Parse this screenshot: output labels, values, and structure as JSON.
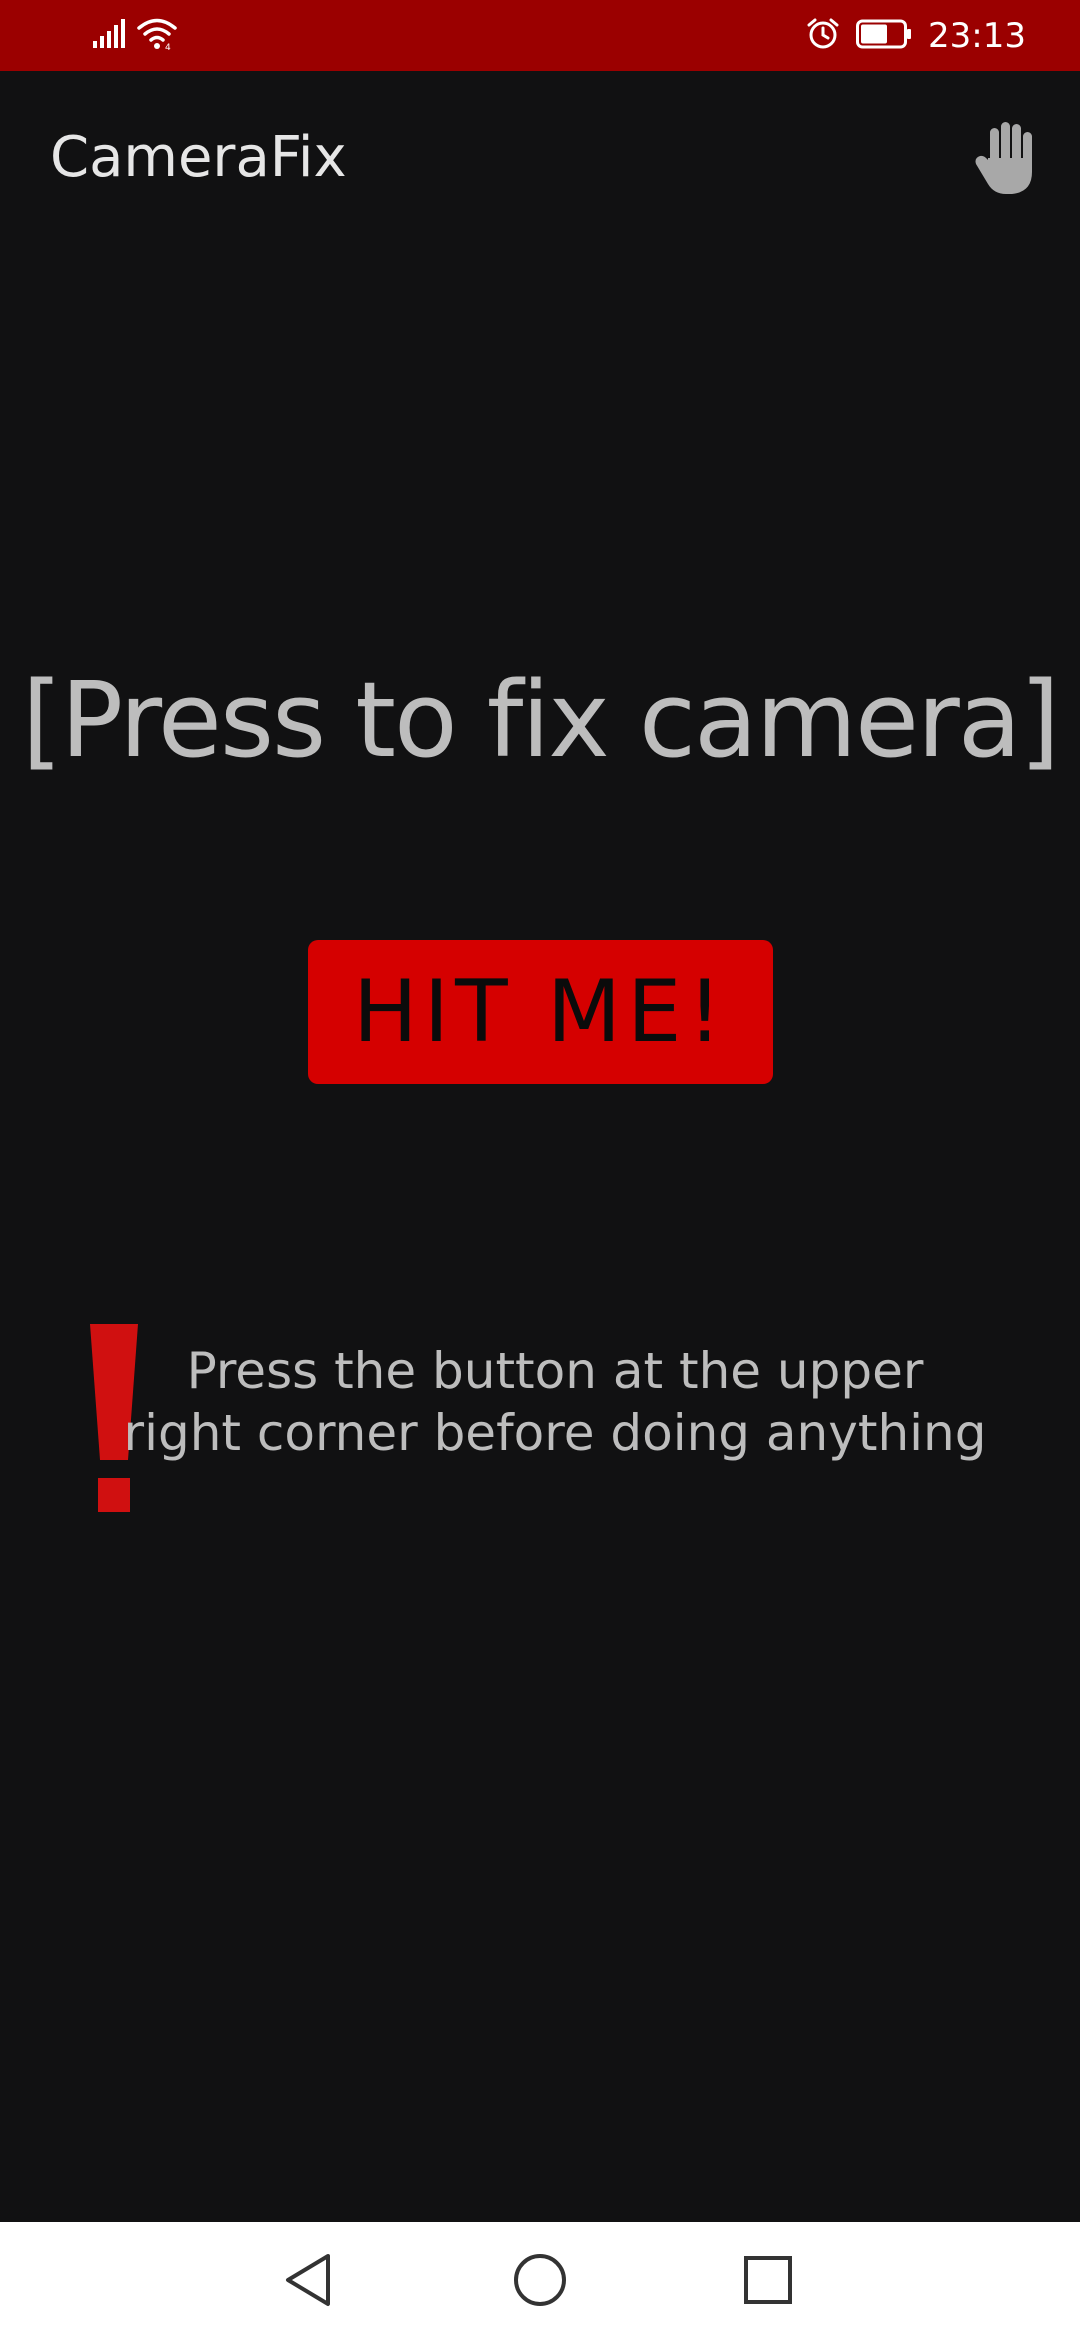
{
  "status_bar": {
    "time": "23:13",
    "background": "#9b0000",
    "icons": [
      "signal-icon",
      "wifi-icon",
      "alarm-icon",
      "battery-icon"
    ]
  },
  "app_bar": {
    "title": "CameraFix",
    "action_icon": "hand-icon"
  },
  "main": {
    "prompt": "[Press to fix camera]",
    "button_label": "HIT ME!",
    "button_color": "#d50000",
    "warning_icon": "exclamation-icon",
    "warning_color": "#d01010",
    "warning_text": "Press the button at the upper right corner before doing anything"
  },
  "nav_bar": {
    "icons": [
      "back-icon",
      "home-icon",
      "recents-icon"
    ]
  }
}
